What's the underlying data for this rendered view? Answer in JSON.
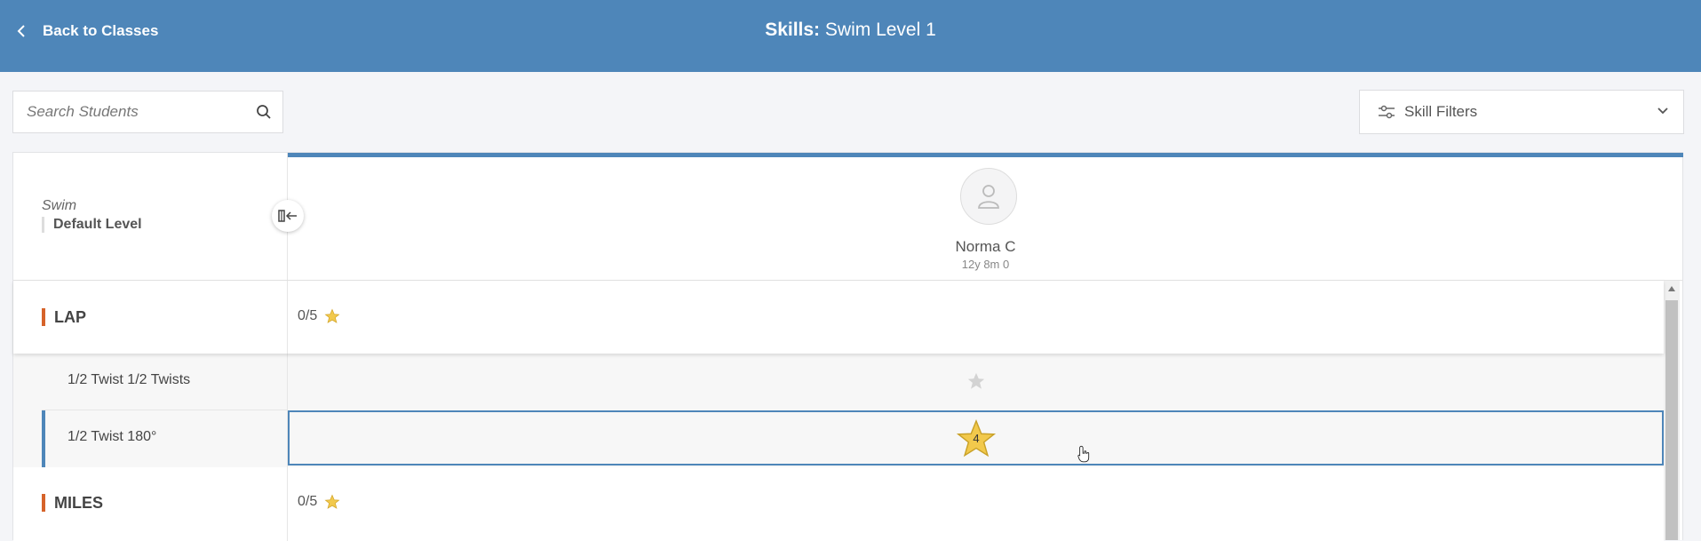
{
  "header": {
    "back_label": "Back to Classes",
    "title_prefix": "Skills:",
    "title_value": "Swim Level 1"
  },
  "search": {
    "placeholder": "Search Students"
  },
  "filters": {
    "label": "Skill Filters"
  },
  "level": {
    "program": "Swim",
    "name": "Default Level"
  },
  "student": {
    "name": "Norma C",
    "age": "12y 8m 0"
  },
  "categories": [
    {
      "name": "LAP",
      "score": "0/5",
      "skills": [
        {
          "name": "1/2 Twist 1/2 Twists",
          "rating": ""
        },
        {
          "name": "1/2 Twist 180°",
          "rating": "4",
          "selected": true
        }
      ]
    },
    {
      "name": "MILES",
      "score": "0/5",
      "skills": []
    }
  ],
  "colors": {
    "brand": "#4e86b9",
    "category_accent": "#d6632a",
    "star_gold": "#f2c94c",
    "star_empty": "#d3d3d3"
  },
  "icons": {
    "back": "chevron-left-icon",
    "search": "search-icon",
    "filters": "sliders-icon",
    "dropdown": "chevron-down-icon",
    "collapse": "collapse-panel-icon",
    "avatar": "user-icon",
    "star": "star-icon"
  }
}
